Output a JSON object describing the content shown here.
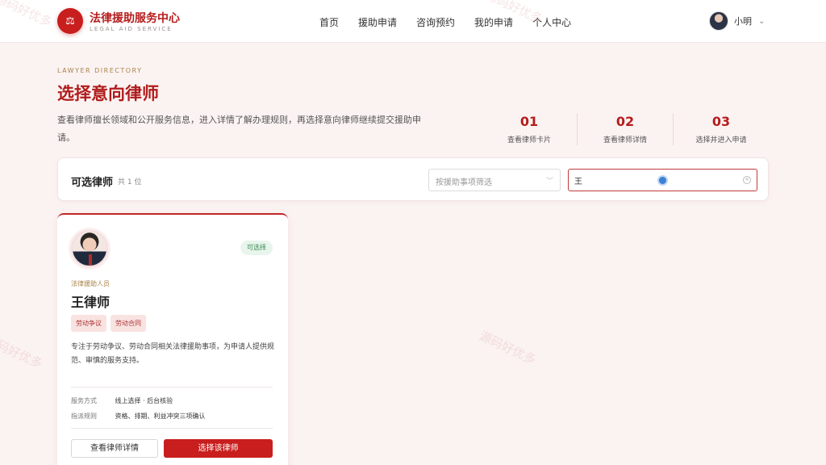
{
  "header": {
    "logo_glyph": "⚖",
    "title": "法律援助服务中心",
    "subtitle": "LEGAL AID SERVICE",
    "nav": [
      "首页",
      "援助申请",
      "咨询预约",
      "我的申请",
      "个人中心"
    ],
    "user_name": "小明"
  },
  "intro": {
    "eyebrow": "LAWYER DIRECTORY",
    "title": "选择意向律师",
    "description": "查看律师擅长领域和公开服务信息，进入详情了解办理规则，再选择意向律师继续提交援助申请。"
  },
  "steps": [
    {
      "num": "01",
      "label": "查看律师卡片"
    },
    {
      "num": "02",
      "label": "查看律师详情"
    },
    {
      "num": "03",
      "label": "选择并进入申请"
    }
  ],
  "filter": {
    "title": "可选律师",
    "count": "共 1 位",
    "select_placeholder": "按援助事项筛选",
    "search_value": "王"
  },
  "lawyer": {
    "status": "可选择",
    "role": "法律援助人员",
    "name": "王律师",
    "tags": [
      "劳动争议",
      "劳动合同"
    ],
    "description": "专注于劳动争议、劳动合同相关法律援助事项，为申请人提供规范、审慎的服务支持。",
    "info": [
      {
        "key": "服务方式",
        "value": "线上选择 · 后台核验"
      },
      {
        "key": "指派规则",
        "value": "资格、排期、利益冲突三项确认"
      }
    ],
    "detail_button": "查看律师详情",
    "select_button": "选择该律师"
  },
  "watermark": "源码好优多",
  "colors": {
    "brand_red": "#c81e1e",
    "page_bg": "#fbf3f2",
    "accent_gold": "#a8824a",
    "available_green": "#3c8a55"
  }
}
